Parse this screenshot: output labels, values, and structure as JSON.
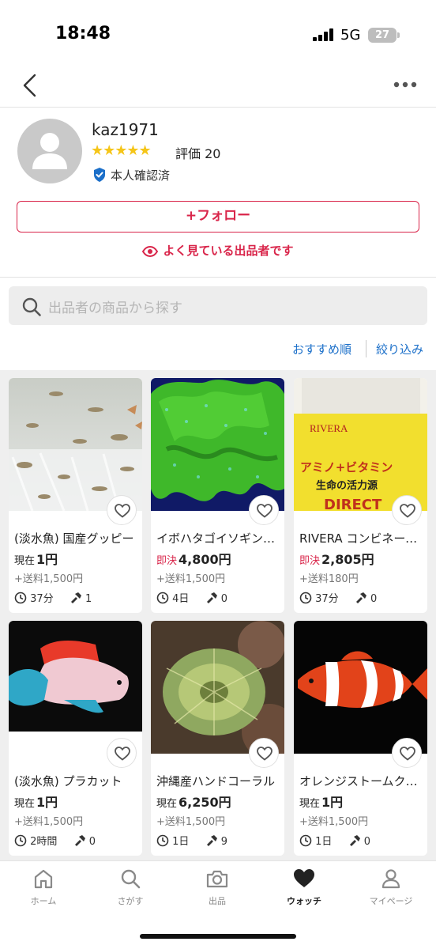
{
  "status_bar": {
    "time": "18:48",
    "network": "5G",
    "battery": "27"
  },
  "nav": {
    "back_icon": "chevron-left-icon",
    "more_icon": "ellipsis-icon"
  },
  "seller": {
    "name": "kaz1971",
    "stars": "★★★★★",
    "rating_label": "評価 20",
    "verified_label": "本人確認済",
    "follow_label": "+フォロー",
    "often_viewed_label": "よく見ている出品者です"
  },
  "search": {
    "placeholder": "出品者の商品から探す"
  },
  "sort": {
    "sort_label": "おすすめ順",
    "filter_label": "絞り込み"
  },
  "colors": {
    "accent": "#d9254a",
    "link": "#1b6fc9",
    "star": "#f5c518"
  },
  "products": [
    {
      "title": "(淡水魚) 国産グッピー",
      "price_type": "現在",
      "price": "1円",
      "shipping": "+送料1,500円",
      "time_left": "37分",
      "bids": "1"
    },
    {
      "title": "イボハタゴイソギンチャク",
      "price_type": "即決",
      "price": "4,800円",
      "shipping": "+送料1,500円",
      "time_left": "4日",
      "bids": "0"
    },
    {
      "title": "RIVERA コンビネーション",
      "price_type": "即決",
      "price": "2,805円",
      "shipping": "+送料180円",
      "time_left": "37分",
      "bids": "0"
    },
    {
      "title": "(淡水魚) プラカット",
      "price_type": "現在",
      "price": "1円",
      "shipping": "+送料1,500円",
      "time_left": "2時間",
      "bids": "0"
    },
    {
      "title": "沖縄産ハンドコーラル",
      "price_type": "現在",
      "price": "6,250円",
      "shipping": "+送料1,500円",
      "time_left": "1日",
      "bids": "9"
    },
    {
      "title": "オレンジストームクラウン",
      "price_type": "現在",
      "price": "1円",
      "shipping": "+送料1,500円",
      "time_left": "1日",
      "bids": "0"
    }
  ],
  "product_image_text": {
    "brand": "RIVERA",
    "line1": "アミノ+ビタミン",
    "line2": "生命の活力源",
    "line3": "DIRECT"
  },
  "tabs": [
    {
      "label": "ホーム",
      "icon": "home-icon"
    },
    {
      "label": "さがす",
      "icon": "search-icon"
    },
    {
      "label": "出品",
      "icon": "camera-icon"
    },
    {
      "label": "ウォッチ",
      "icon": "heart-icon",
      "active": true
    },
    {
      "label": "マイページ",
      "icon": "person-icon"
    }
  ]
}
